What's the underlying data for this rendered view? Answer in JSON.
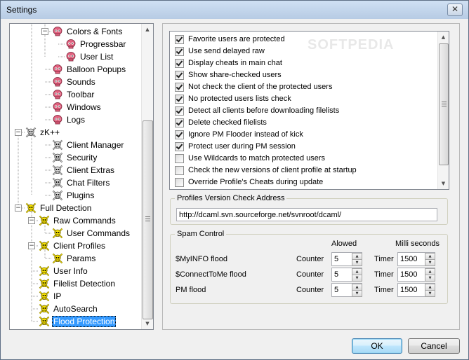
{
  "window": {
    "title": "Settings",
    "close_glyph": "✕"
  },
  "watermark": "SOFTPEDIA",
  "tree": {
    "nodes": [
      {
        "label": "Colors & Fonts",
        "icon": "pink-skull-icon",
        "toggle": "−"
      },
      {
        "label": "Progressbar",
        "icon": "pink-skull-icon",
        "toggle": ""
      },
      {
        "label": "User List",
        "icon": "pink-skull-icon",
        "toggle": ""
      },
      {
        "label": "Balloon Popups",
        "icon": "pink-skull-icon",
        "toggle": ""
      },
      {
        "label": "Sounds",
        "icon": "pink-skull-icon",
        "toggle": ""
      },
      {
        "label": "Toolbar",
        "icon": "pink-skull-icon",
        "toggle": ""
      },
      {
        "label": "Windows",
        "icon": "pink-skull-icon",
        "toggle": ""
      },
      {
        "label": "Logs",
        "icon": "pink-skull-icon",
        "toggle": ""
      },
      {
        "label": "zK++",
        "icon": "gray-skull-crossbones-icon",
        "toggle": "−"
      },
      {
        "label": "Client Manager",
        "icon": "gray-skull-crossbones-icon",
        "toggle": ""
      },
      {
        "label": "Security",
        "icon": "gray-skull-crossbones-icon",
        "toggle": ""
      },
      {
        "label": "Client Extras",
        "icon": "gray-skull-crossbones-icon",
        "toggle": ""
      },
      {
        "label": "Chat Filters",
        "icon": "gray-skull-crossbones-icon",
        "toggle": ""
      },
      {
        "label": "Plugins",
        "icon": "gray-skull-crossbones-icon",
        "toggle": ""
      },
      {
        "label": "Full Detection",
        "icon": "yellow-skull-crossbones-icon",
        "toggle": "−"
      },
      {
        "label": "Raw Commands",
        "icon": "yellow-skull-crossbones-icon",
        "toggle": "−"
      },
      {
        "label": "User Commands",
        "icon": "yellow-skull-crossbones-icon",
        "toggle": ""
      },
      {
        "label": "Client Profiles",
        "icon": "yellow-skull-crossbones-icon",
        "toggle": "−"
      },
      {
        "label": "Params",
        "icon": "yellow-skull-crossbones-icon",
        "toggle": ""
      },
      {
        "label": "User Info",
        "icon": "yellow-skull-crossbones-icon",
        "toggle": ""
      },
      {
        "label": "Filelist Detection",
        "icon": "yellow-skull-crossbones-icon",
        "toggle": ""
      },
      {
        "label": "IP",
        "icon": "yellow-skull-crossbones-icon",
        "toggle": ""
      },
      {
        "label": "AutoSearch",
        "icon": "yellow-skull-crossbones-icon",
        "toggle": ""
      },
      {
        "label": "Flood Protection",
        "icon": "yellow-skull-crossbones-icon",
        "toggle": "",
        "selected": true
      }
    ]
  },
  "options": [
    {
      "label": "Favorite users are protected",
      "checked": true
    },
    {
      "label": "Use send delayed raw",
      "checked": true
    },
    {
      "label": "Display cheats in main chat",
      "checked": true
    },
    {
      "label": "Show share-checked users",
      "checked": true
    },
    {
      "label": "Not check the client of the protected users",
      "checked": true
    },
    {
      "label": "No protected users lists check",
      "checked": true
    },
    {
      "label": "Detect all clients before downloading filelists",
      "checked": true
    },
    {
      "label": "Delete checked filelists",
      "checked": true
    },
    {
      "label": "Ignore PM Flooder instead of kick",
      "checked": true
    },
    {
      "label": "Protect user during PM session",
      "checked": true
    },
    {
      "label": "Use Wildcards to match protected users",
      "checked": false
    },
    {
      "label": "Check the new versions of client profile at startup",
      "checked": false
    },
    {
      "label": "Override Profile's Cheats during update",
      "checked": false
    }
  ],
  "profiles_version": {
    "legend": "Profiles Version Check Address",
    "url": "http://dcaml.svn.sourceforge.net/svnroot/dcaml/"
  },
  "spam_control": {
    "legend": "Spam Control",
    "allowed_header": "Alowed",
    "ms_header": "Milli seconds",
    "counter_label": "Counter",
    "timer_label": "Timer",
    "rows": [
      {
        "name": "$MyINFO flood",
        "counter": "5",
        "timer": "1500"
      },
      {
        "name": "$ConnectToMe flood",
        "counter": "5",
        "timer": "1500"
      },
      {
        "name": "PM flood",
        "counter": "5",
        "timer": "1500"
      }
    ]
  },
  "buttons": {
    "ok": "OK",
    "cancel": "Cancel"
  },
  "colors": {
    "selection": "#3399ff",
    "pink_skull": "#e0607e",
    "yellow_skull": "#f5e000",
    "gray_skull": "#9a9a9a"
  }
}
